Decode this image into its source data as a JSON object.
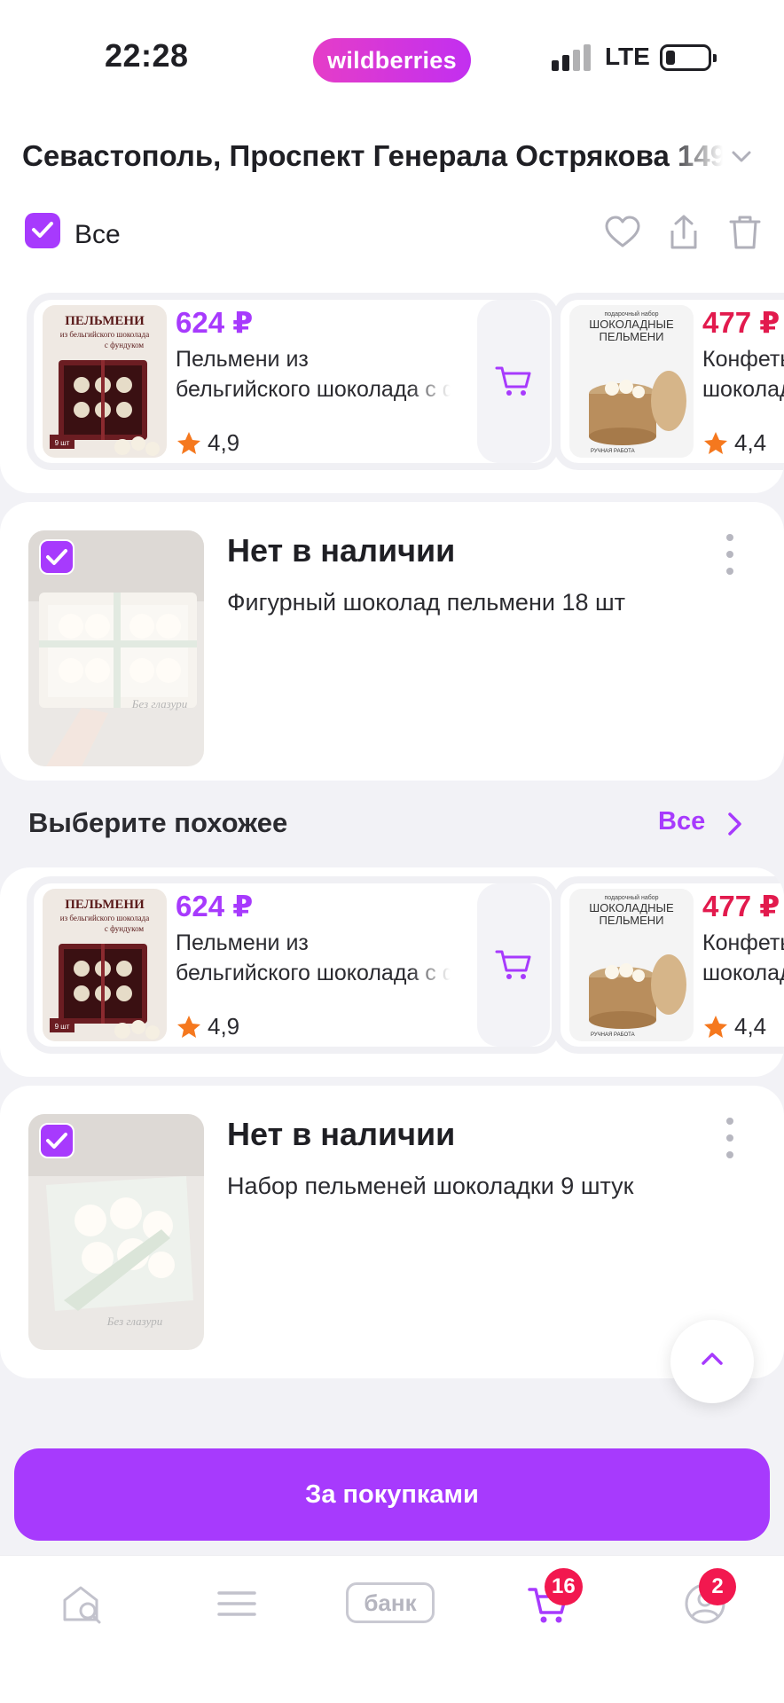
{
  "status_bar": {
    "time": "22:28",
    "network": "LTE",
    "brand": "wildberries"
  },
  "address": {
    "text": "Севастополь, Проспект Генерала Острякова 149"
  },
  "selection": {
    "all_label": "Все",
    "all_checked": true
  },
  "recommendations": [
    {
      "price": "624 ₽",
      "title_line1": "Пельмени из",
      "title_line2": "бельгийского шоколада с фундуком",
      "rating": "4,9",
      "thumb_lines": [
        "ПЕЛЬМЕНИ",
        "из бельгийского шоколада",
        "с фундуком",
        "9 шт"
      ]
    },
    {
      "price": "477 ₽",
      "title_line1": "Конфеты",
      "title_line2": "шоколадные",
      "rating": "4,4",
      "thumb_lines": [
        "подарочный набор",
        "ШОКОЛАДНЫЕ",
        "ПЕЛЬМЕНИ",
        "РУЧНАЯ РАБОТА"
      ]
    }
  ],
  "items": [
    {
      "status": "Нет в наличии",
      "name": "Фигурный шоколад пельмени 18 шт",
      "thumb_caption": "Без глазури",
      "checked": true
    },
    {
      "status": "Нет в наличии",
      "name": "Набор пельменей шоколадки 9 штук",
      "thumb_caption": "Без глазури",
      "checked": true
    }
  ],
  "similar": {
    "title": "Выберите похожее",
    "all_label": "Все"
  },
  "primary_button": {
    "label": "За покупками"
  },
  "tabbar": {
    "bank_label": "банк",
    "cart_badge": "16",
    "profile_badge": "2",
    "active_tab": "cart"
  },
  "colors": {
    "accent": "#a73afd",
    "price_red": "#e21a4d",
    "badge": "#f2184f",
    "rating_star": "#f5781e"
  }
}
